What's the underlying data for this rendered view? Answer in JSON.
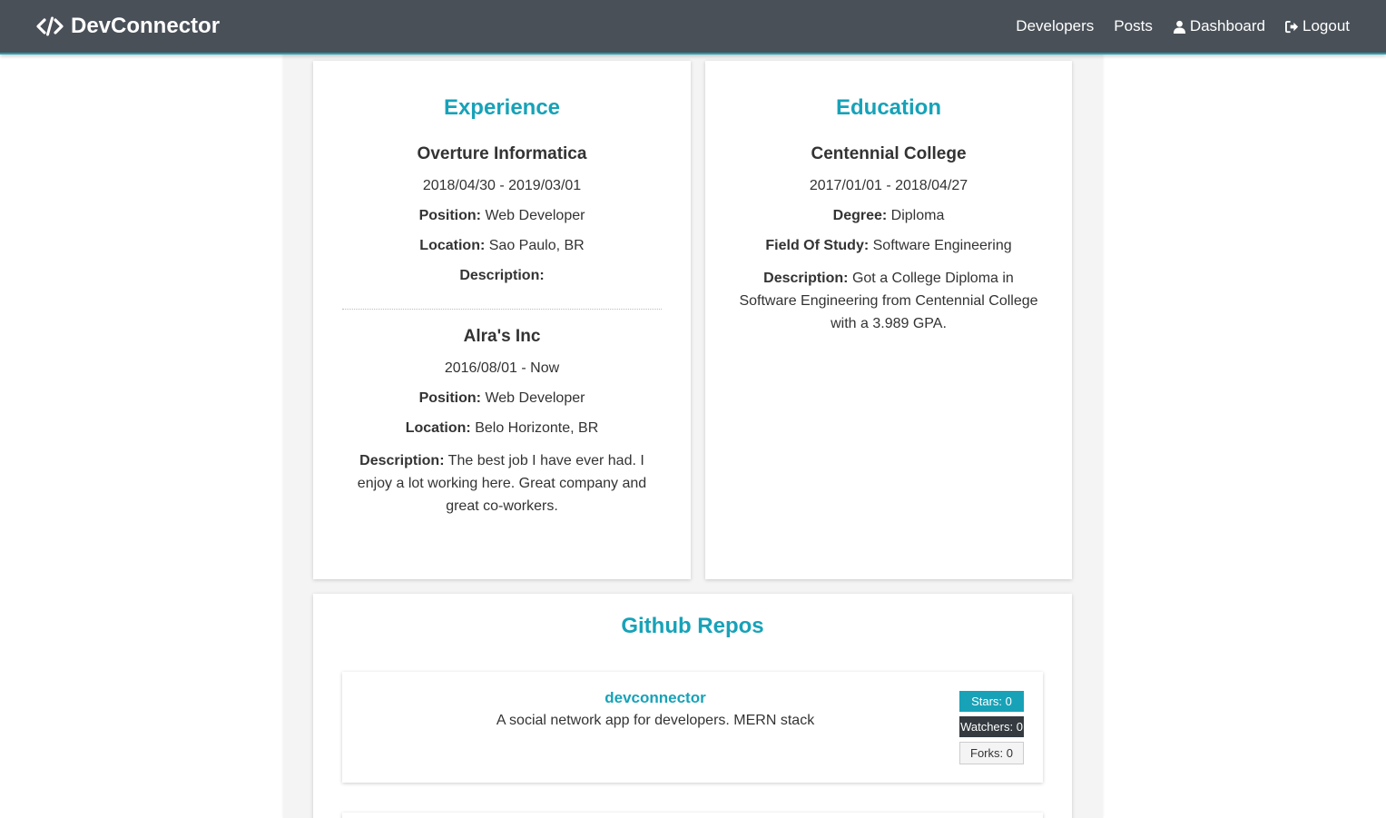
{
  "navbar": {
    "brand": "DevConnector",
    "links": {
      "developers": "Developers",
      "posts": "Posts",
      "dashboard": "Dashboard",
      "logout": "Logout"
    }
  },
  "experience": {
    "title": "Experience",
    "items": [
      {
        "company": "Overture Informatica",
        "dates": "2018/04/30 - 2019/03/01",
        "position_label": "Position:",
        "position": "Web Developer",
        "location_label": "Location:",
        "location": "Sao Paulo, BR",
        "description_label": "Description:",
        "description": ""
      },
      {
        "company": "Alra's Inc",
        "dates": "2016/08/01 - Now",
        "position_label": "Position:",
        "position": "Web Developer",
        "location_label": "Location:",
        "location": "Belo Horizonte, BR",
        "description_label": "Description:",
        "description": "The best job I have ever had. I enjoy a lot working here. Great company and great co-workers."
      }
    ]
  },
  "education": {
    "title": "Education",
    "items": [
      {
        "school": "Centennial College",
        "dates": "2017/01/01 - 2018/04/27",
        "degree_label": "Degree:",
        "degree": "Diploma",
        "field_label": "Field Of Study:",
        "field": "Software Engineering",
        "description_label": "Description:",
        "description": "Got a College Diploma in Software Engineering from Centennial College with a 3.989 GPA."
      }
    ]
  },
  "repos": {
    "title": "Github Repos",
    "items": [
      {
        "name": "devconnector",
        "description": "A social network app for developers. MERN stack",
        "stars": "Stars: 0",
        "watchers": "Watchers: 0",
        "forks": "Forks: 0"
      }
    ]
  },
  "colors": {
    "accent": "#17a2b8",
    "navbar": "#495058",
    "dark": "#343a40"
  }
}
